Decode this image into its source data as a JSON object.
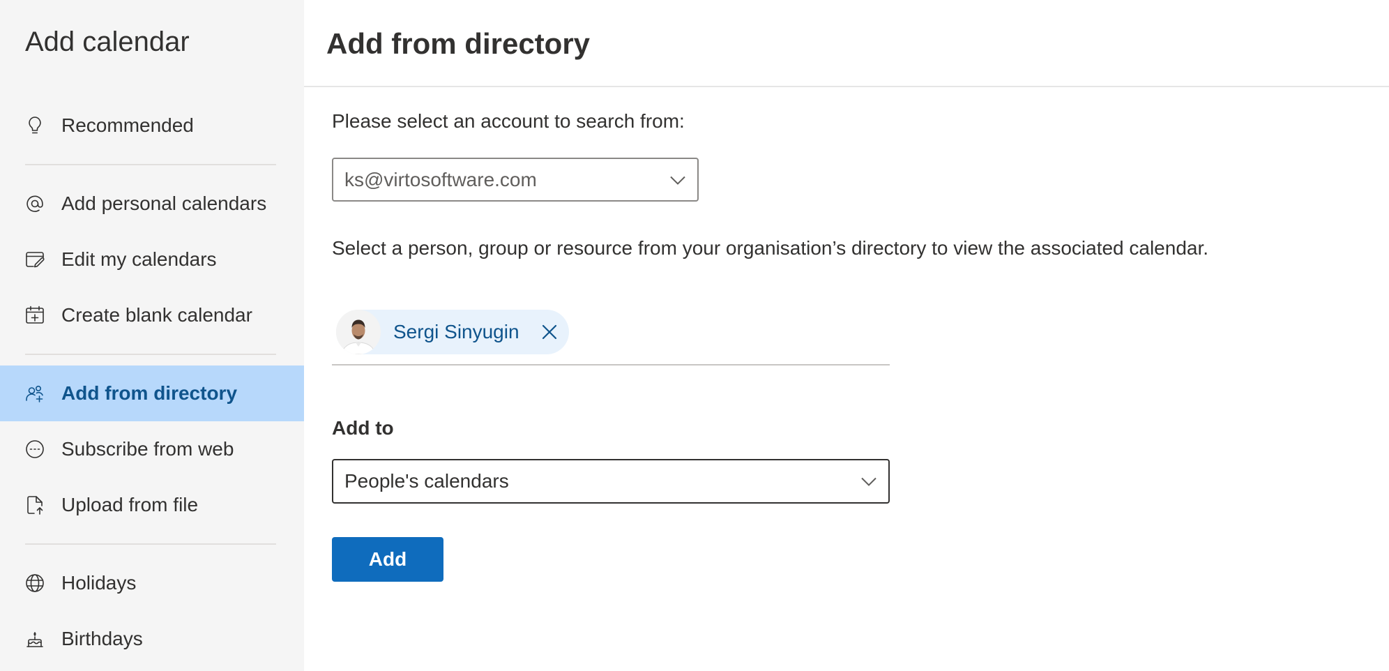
{
  "sidebar": {
    "title": "Add calendar",
    "items": [
      {
        "id": "recommended",
        "label": "Recommended",
        "icon": "lightbulb-icon"
      },
      {
        "id": "add-personal-calendars",
        "label": "Add personal calendars",
        "icon": "at-sign-icon"
      },
      {
        "id": "edit-my-calendars",
        "label": "Edit my calendars",
        "icon": "edit-calendar-icon"
      },
      {
        "id": "create-blank-calendar",
        "label": "Create blank calendar",
        "icon": "calendar-add-icon"
      },
      {
        "id": "add-from-directory",
        "label": "Add from directory",
        "icon": "people-add-icon",
        "selected": true
      },
      {
        "id": "subscribe-from-web",
        "label": "Subscribe from web",
        "icon": "web-link-icon"
      },
      {
        "id": "upload-from-file",
        "label": "Upload from file",
        "icon": "file-upload-icon"
      },
      {
        "id": "holidays",
        "label": "Holidays",
        "icon": "globe-icon"
      },
      {
        "id": "birthdays",
        "label": "Birthdays",
        "icon": "cake-icon"
      }
    ]
  },
  "main": {
    "title": "Add from directory",
    "account_prompt": "Please select an account to search from:",
    "account_value": "ks@virtosoftware.com",
    "description": "Select a person, group or resource from your organisation’s directory to view the associated calendar.",
    "selected_person": "Sergi Sinyugin",
    "add_to_label": "Add to",
    "add_to_value": "People's calendars",
    "add_button": "Add"
  },
  "colors": {
    "sidebar_bg": "#f5f5f5",
    "selected_bg": "#b7d8fb",
    "selected_text": "#0f548c",
    "primary_button": "#0f6cbd",
    "persona_bg": "#e8f2fc"
  }
}
